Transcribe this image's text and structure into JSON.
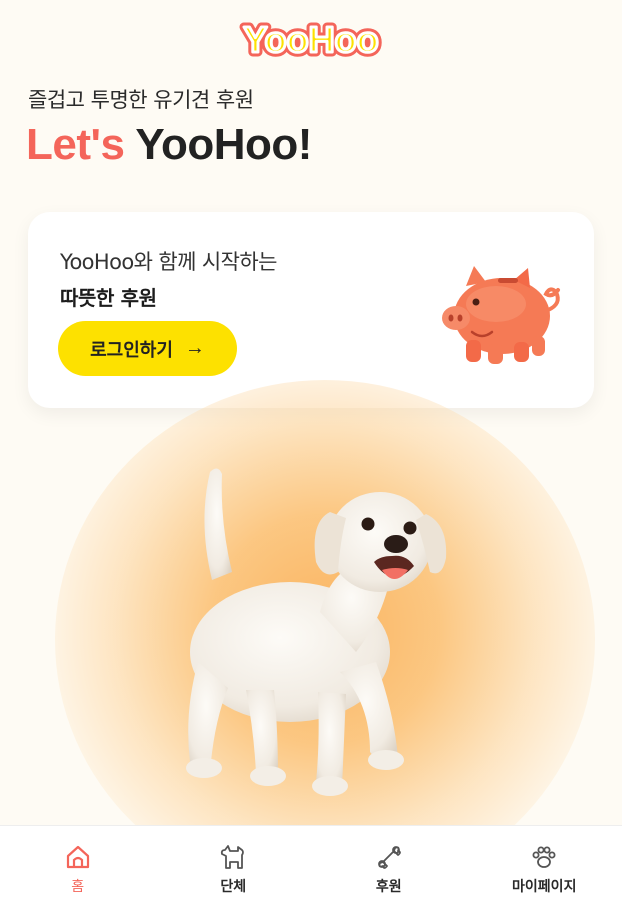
{
  "app": {
    "logo_text": "YooHoo"
  },
  "hero": {
    "subtitle": "즐겁고 투명한 유기견 후원",
    "title_accent": "Let's",
    "title_main": "YooHoo!"
  },
  "card": {
    "line1": "YooHoo와 함께 시작하는",
    "line2": "따뜻한 후원",
    "login_label": "로그인하기",
    "login_arrow": "→"
  },
  "nav": {
    "items": [
      {
        "label": "홈",
        "icon": "home-icon",
        "active": true
      },
      {
        "label": "단체",
        "icon": "dog-icon",
        "active": false
      },
      {
        "label": "후원",
        "icon": "bone-icon",
        "active": false
      },
      {
        "label": "마이페이지",
        "icon": "paw-icon",
        "active": false
      }
    ]
  },
  "colors": {
    "accent": "#f4655a",
    "button_yellow": "#fde100",
    "background": "#fefbf4"
  }
}
